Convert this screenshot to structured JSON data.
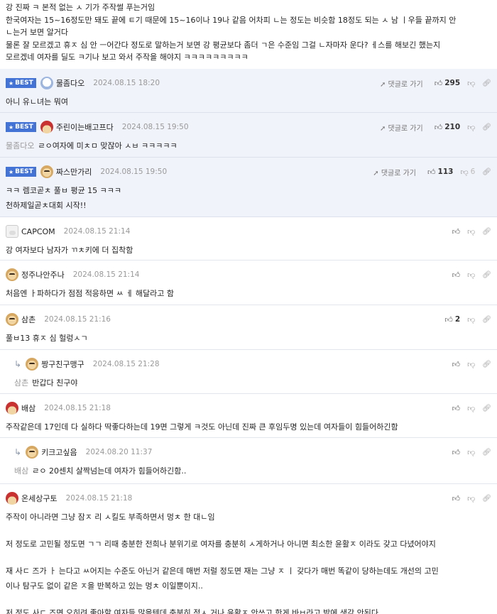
{
  "post": {
    "lines": [
      "강 진짜 ㅋ 본적 없는 ㅅ 기가 주작썰 푸는거임",
      "한국여자는 15~16정도만 돼도 끝에 ㅌ기 때문에 15~16이나 19나 같음 어차피 ㄴ는 정도는 비슷함 18정도 되는 ㅅ 남 ㅣ우들 끝까지 안",
      "ㄴ는거 보면 알거다",
      "물론 잘 모르겠고 휴ㅈ 심 안 ㅡ어간다 정도로 말하는거 보면 강 평균보다 좀더 ㄱ은 수준임 그걸 ㄴ자마자 운다? ㅔ스를 해보긴 했는지",
      "모르겠네 여자를 딜도 ㅋ기나 보고 와서 주작을 해야지 ㅋㅋㅋㅋㅋㅋㅋㅋㅋ"
    ]
  },
  "ui": {
    "best_label": "BEST",
    "goto_label": "댓글로 가기"
  },
  "comments": [
    {
      "best": true,
      "avatar": "ghost",
      "nick": "물좀다오",
      "date": "2024.08.15 18:20",
      "up": "295",
      "down": "",
      "text": [
        "아니 유ㄴ녀는 뭐여"
      ]
    },
    {
      "best": true,
      "avatar": "santa",
      "nick": "주린이는배고프다",
      "date": "2024.08.15 19:50",
      "up": "210",
      "down": "",
      "mention": "물좀다오",
      "text": [
        "ㄹㅇ여자에 미ㅊㅁ 맞잖아 ㅅㅂ ㅋㅋㅋㅋㅋ"
      ]
    },
    {
      "best": true,
      "avatar": "dog",
      "nick": "짜스만가리",
      "date": "2024.08.15 19:50",
      "up": "113",
      "down": "6",
      "text": [
        "ㅋㅋ 렘코곧ㅊ 풀ㅂ 평균 15 ㅋㅋㅋ",
        "천하제일곧ㅊ대회 시작!!"
      ]
    },
    {
      "avatar": "white",
      "nick": "CAPCOM",
      "date": "2024.08.15 21:14",
      "up": "",
      "text": [
        "강 여자보다 남자가 ㄲㅊ키에 더 집착함"
      ]
    },
    {
      "avatar": "dog",
      "nick": "정주나안주나",
      "date": "2024.08.15 21:14",
      "up": "",
      "text": [
        "처음엔 ㅏ파하다가 점점 적응하면 ㅆ ㅔ 해달라고 함"
      ]
    },
    {
      "avatar": "dog",
      "nick": "삼촌",
      "date": "2024.08.15 21:16",
      "up": "2",
      "text": [
        "풀ㅂ13 휴ㅈ 심 헐렁ㅅㄱ"
      ]
    },
    {
      "reply": true,
      "avatar": "dog",
      "nick": "짱구친구맹구",
      "date": "2024.08.15 21:28",
      "up": "",
      "mention": "삼촌",
      "text": [
        "반갑다 친구야"
      ]
    },
    {
      "avatar": "santa",
      "nick": "배삼",
      "date": "2024.08.15 21:18",
      "up": "",
      "text": [
        "주작같은데 17인데 다 실하다 딱좋다하는데 19면 그렇게 ㅋ것도 아닌데 진짜 큰 후임두명 있는데 여자들이 힘들어하긴함"
      ]
    },
    {
      "reply": true,
      "avatar": "dog",
      "nick": "키크고싶음",
      "date": "2024.08.20 11:37",
      "up": "",
      "mention": "배삼",
      "text": [
        "ㄹㅇ 20센치 살짝넘는데 여자가 힘들어하긴함.."
      ]
    },
    {
      "avatar": "santa",
      "nick": "온세상구토",
      "date": "2024.08.15 21:18",
      "up": "",
      "text": [
        "주작이 아니라면 그냥 잠ㅈ 리 ㅅ킬도 부족하면서 멍ㅊ 한 대ㄴ임",
        "",
        "저 정도로 고민될 정도면 ㄱㄱ 리때 충분한 전희나 분위기로 여자를 충분히 ㅅ게하거나 아니면 최소한 윤활ㅈ 이라도 갖고 다녔어야지",
        "",
        "재 사ㄷ 즈가 ㅏ 는다고 ㅆ어지는 수준도 아닌거 같은데 매번 저럴 정도면 재는 그냥 ㅈ ㅣ 갖다가 매번 똑같이 당하는데도 개선의 고민",
        "이나 탐구도 없이 같은 ㅈ을 반복하고 있는 멍ㅊ 이일뿐이지..",
        "",
        "저 정도 사ㄷ 즈면 오히려 좋아할 여자들 많을텐데 충분히 적ㅅ 거나 윤활ㅈ 안쓰고 한게 바ㅂ라고 밖에 생각 안된다"
      ]
    }
  ]
}
